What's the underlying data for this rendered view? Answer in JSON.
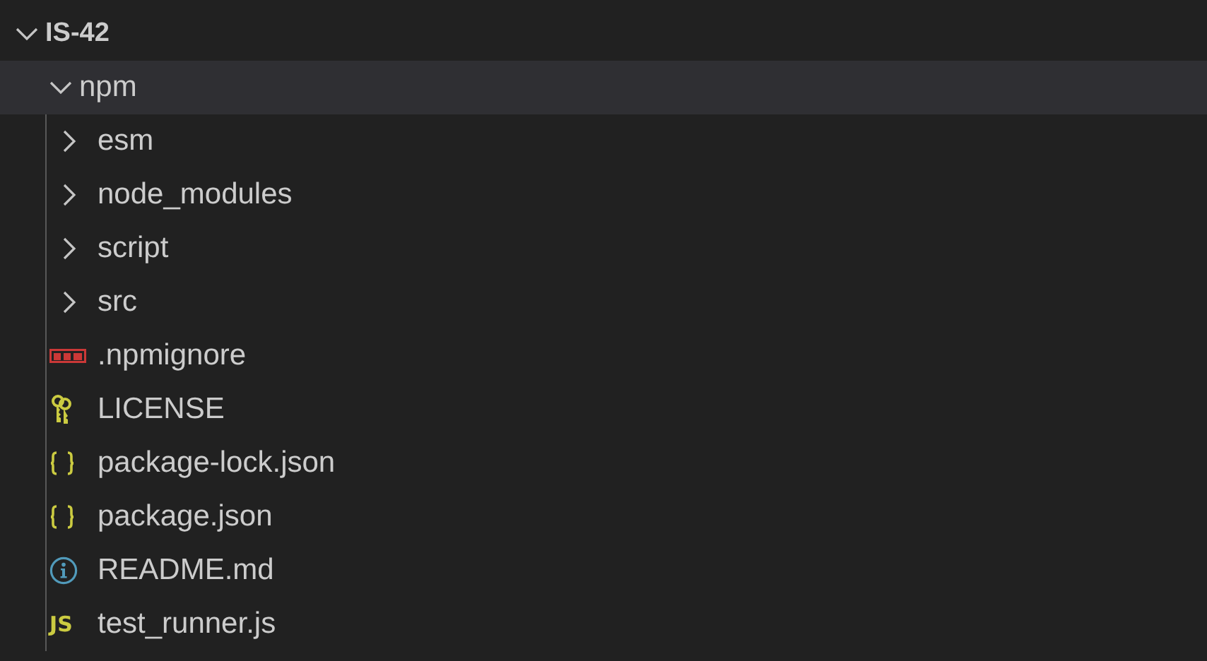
{
  "explorer": {
    "root": {
      "name": "IS-42",
      "expanded": true,
      "selected": false,
      "children": [
        {
          "kind": "folder",
          "name": "npm",
          "expanded": true,
          "selected": true,
          "children": [
            {
              "kind": "folder",
              "name": "esm",
              "expanded": false,
              "selected": false
            },
            {
              "kind": "folder",
              "name": "node_modules",
              "expanded": false,
              "selected": false
            },
            {
              "kind": "folder",
              "name": "script",
              "expanded": false,
              "selected": false
            },
            {
              "kind": "folder",
              "name": "src",
              "expanded": false,
              "selected": false
            },
            {
              "kind": "npm",
              "name": ".npmignore",
              "selected": false
            },
            {
              "kind": "license",
              "name": "LICENSE",
              "selected": false
            },
            {
              "kind": "json",
              "name": "package-lock.json",
              "selected": false
            },
            {
              "kind": "json",
              "name": "package.json",
              "selected": false
            },
            {
              "kind": "readme",
              "name": "README.md",
              "selected": false
            },
            {
              "kind": "js",
              "badge": "JS",
              "name": "test_runner.js",
              "selected": false
            }
          ]
        }
      ]
    }
  }
}
